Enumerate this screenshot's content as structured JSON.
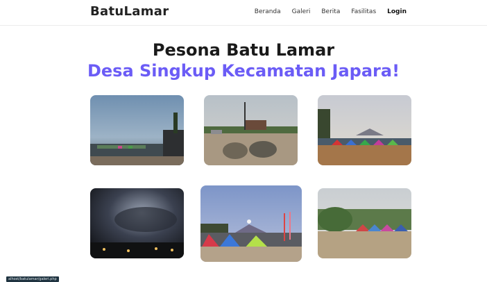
{
  "navbar": {
    "brand": "BatuLamar",
    "links": [
      {
        "label": "Beranda"
      },
      {
        "label": "Galeri"
      },
      {
        "label": "Berita"
      },
      {
        "label": "Fasilitas"
      },
      {
        "label": "Login"
      }
    ]
  },
  "hero": {
    "title": "Pesona Batu Lamar",
    "subtitle": "Desa Singkup Kecamatan Japara!"
  },
  "colors": {
    "accent": "#6b5cf6",
    "text": "#1a1a1a"
  },
  "status_url": "alhost/batulamar/galeri.php"
}
